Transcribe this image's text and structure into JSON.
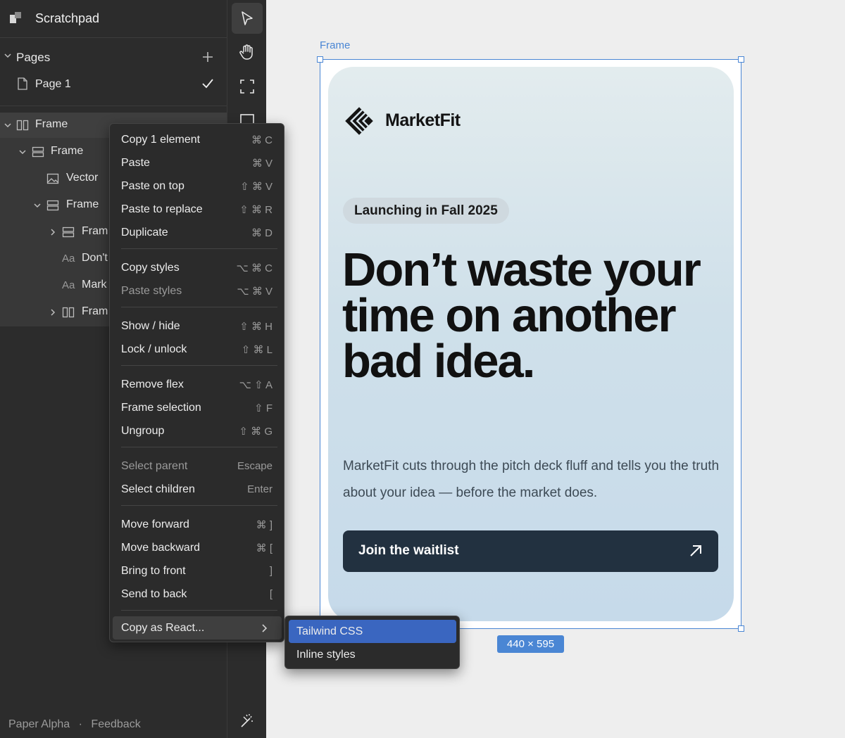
{
  "app": {
    "title": "Scratchpad"
  },
  "pages": {
    "title": "Pages",
    "items": [
      {
        "label": "Page 1",
        "current": true
      }
    ]
  },
  "layers": [
    {
      "label": "Frame",
      "prefix": ""
    },
    {
      "label": "Frame",
      "prefix": ""
    },
    {
      "label": "Vector",
      "prefix": ""
    },
    {
      "label": "Frame",
      "prefix": ""
    },
    {
      "label": "Fram",
      "prefix": ""
    },
    {
      "label": "Don't",
      "prefix": "Aa"
    },
    {
      "label": "Mark",
      "prefix": "Aa"
    },
    {
      "label": "Fram",
      "prefix": ""
    }
  ],
  "footer": {
    "product": "Paper Alpha",
    "separator": "·",
    "feedback": "Feedback"
  },
  "canvas": {
    "frame_label": "Frame",
    "dimensions": "440 × 595"
  },
  "card": {
    "brand": "MarketFit",
    "badge": "Launching in Fall 2025",
    "headline": "Don’t waste your time on another bad idea.",
    "subtext": "MarketFit cuts through the pitch deck fluff and tells you the truth about your idea — before the market does.",
    "cta": "Join the waitlist",
    "colors": {
      "cta_bg": "#223140",
      "selection": "#4a86d4"
    }
  },
  "context_menu": [
    {
      "label": "Copy 1 element",
      "shortcut": "⌘ C"
    },
    {
      "label": "Paste",
      "shortcut": "⌘ V"
    },
    {
      "label": "Paste on top",
      "shortcut": "⇧ ⌘ V"
    },
    {
      "label": "Paste to replace",
      "shortcut": "⇧ ⌘ R"
    },
    {
      "label": "Duplicate",
      "shortcut": "⌘ D"
    },
    {
      "label": "Copy styles",
      "shortcut": "⌥ ⌘ C"
    },
    {
      "label": "Paste styles",
      "shortcut": "⌥ ⌘ V"
    },
    {
      "label": "Show / hide",
      "shortcut": "⇧ ⌘ H"
    },
    {
      "label": "Lock / unlock",
      "shortcut": "⇧ ⌘ L"
    },
    {
      "label": "Remove flex",
      "shortcut": "⌥ ⇧ A"
    },
    {
      "label": "Frame selection",
      "shortcut": "⇧ F"
    },
    {
      "label": "Ungroup",
      "shortcut": "⇧ ⌘ G"
    },
    {
      "label": "Select parent",
      "shortcut": "Escape"
    },
    {
      "label": "Select children",
      "shortcut": "Enter"
    },
    {
      "label": "Move forward",
      "shortcut": "⌘ ]"
    },
    {
      "label": "Move backward",
      "shortcut": "⌘ ["
    },
    {
      "label": "Bring to front",
      "shortcut": "]"
    },
    {
      "label": "Send to back",
      "shortcut": "["
    },
    {
      "label": "Copy as React...",
      "shortcut": ""
    }
  ],
  "submenu": [
    {
      "label": "Tailwind CSS"
    },
    {
      "label": "Inline styles"
    }
  ]
}
